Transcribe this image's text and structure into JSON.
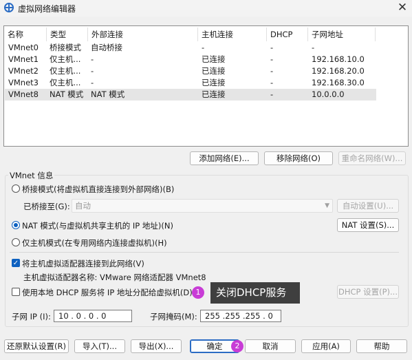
{
  "window": {
    "title": "虚拟网络编辑器",
    "close_glyph": "✕"
  },
  "table": {
    "headers": [
      "名称",
      "类型",
      "外部连接",
      "主机连接",
      "DHCP",
      "子网地址"
    ],
    "rows": [
      [
        "VMnet0",
        "桥接模式",
        "自动桥接",
        "-",
        "-",
        "-"
      ],
      [
        "VMnet1",
        "仅主机...",
        "-",
        "已连接",
        "-",
        "192.168.10.0"
      ],
      [
        "VMnet2",
        "仅主机...",
        "-",
        "已连接",
        "-",
        "192.168.20.0"
      ],
      [
        "VMnet3",
        "仅主机...",
        "-",
        "已连接",
        "-",
        "192.168.30.0"
      ],
      [
        "VMnet8",
        "NAT 模式",
        "NAT 模式",
        "已连接",
        "-",
        "10.0.0.0"
      ]
    ],
    "selected_row": 4
  },
  "table_buttons": {
    "add": "添加网络(E)...",
    "remove": "移除网络(O)",
    "rename": "重命名网络(W)..."
  },
  "vmnet_info": {
    "group_label": "VMnet 信息",
    "bridged_label": "桥接模式(将虚拟机直接连接到外部网络)(B)",
    "bridged_to_label": "已桥接至(G):",
    "bridged_to_value": "自动",
    "auto_settings": "自动设置(U)...",
    "nat_label": "NAT 模式(与虚拟机共享主机的 IP 地址)(N)",
    "nat_settings": "NAT 设置(S)...",
    "hostonly_label": "仅主机模式(在专用网络内连接虚拟机)(H)",
    "selected_mode": "nat",
    "connect_adapter_label": "将主机虚拟适配器连接到此网络(V)",
    "connect_adapter_checked": true,
    "adapter_name_label": "主机虚拟适配器名称: VMware 网络适配器 VMnet8",
    "dhcp_label": "使用本地 DHCP 服务将 IP 地址分配给虚拟机(D)",
    "dhcp_checked": false,
    "dhcp_settings": "DHCP 设置(P)...",
    "subnet_ip_label": "子网 IP (I):",
    "subnet_ip": "10 . 0 . 0 . 0",
    "subnet_mask_label": "子网掩码(M):",
    "subnet_mask": "255 .255 .255 . 0"
  },
  "annotations": {
    "badge1": "1",
    "tooltip": "关闭DHCP服务",
    "badge2": "2"
  },
  "footer": {
    "restore": "还原默认设置(R)",
    "import": "导入(T)...",
    "export": "导出(X)...",
    "ok": "确定",
    "cancel": "取消",
    "apply": "应用(A)",
    "help": "帮助"
  }
}
